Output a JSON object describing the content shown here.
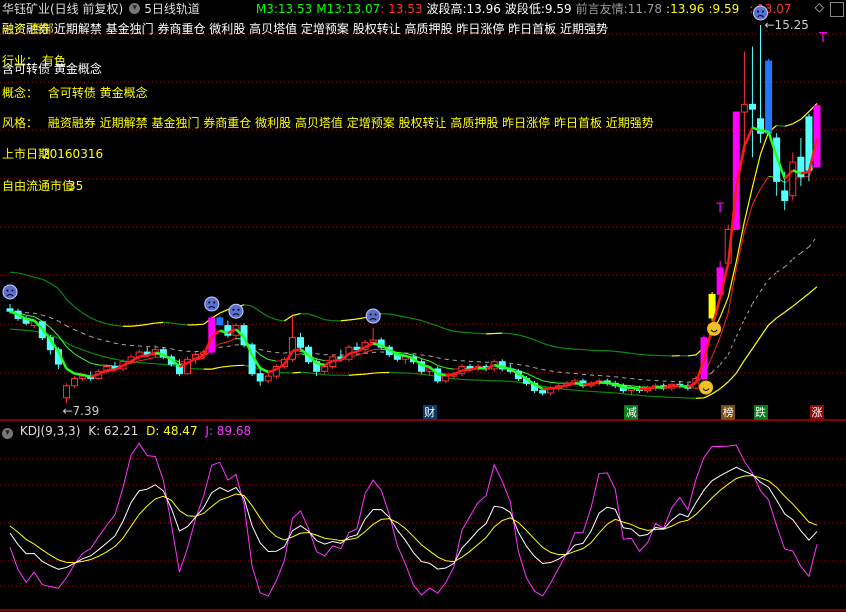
{
  "header": {
    "title": "华钰矿业(日线 前复权)",
    "indicator_name": "5日线轨道",
    "m3_label": "M3:",
    "m3_value": "13.53",
    "m13_label": "M13:",
    "m13_value": "13.07",
    "red_value": ": 13.53",
    "wave_high_label": "波段高:",
    "wave_high_value": "13.96",
    "wave_low_label": "波段低:",
    "wave_low_value": "9.59",
    "friend_label": "前言友情:",
    "friend_value": "11.78",
    "friend_y1": ":13.96",
    "friend_y2": ":9.59",
    "friend_r": ": 13.07"
  },
  "overlay": {
    "tags_line": "融资融券 近期解禁 基金独门 券商重仓 微利股 高贝塔值 定增预案 股权转让 高质押股 昨日涨停 昨日首板 近期强势",
    "tags_overlap": "融资 西部",
    "industry_label": "行业：  有色",
    "industry_overlap": "含可转债 黄金概念",
    "concept_label": "概念：",
    "concept_value": "含可转债 黄金概念",
    "style_label": "风格：",
    "style_value": "融资融券 近期解禁 基金独门 券商重仓 微利股 高贝塔值 定增预案 股权转让 高质押股 昨日涨停 昨日首板 近期强势",
    "listing_label": "上市日期",
    "listing_value": "20160316",
    "float_label": "自由流通市值",
    "float_value": "35"
  },
  "chart_data": {
    "type": "candlestick",
    "price_high_label": "15.25",
    "price_low_label": "7.39",
    "ylim": [
      7.2,
      15.6
    ],
    "candles_ohlc": [
      [
        9.35,
        9.45,
        9.25,
        9.3
      ],
      [
        9.3,
        9.35,
        9.1,
        9.15
      ],
      [
        9.15,
        9.2,
        9.0,
        9.05
      ],
      [
        9.0,
        9.1,
        8.95,
        9.08
      ],
      [
        9.08,
        9.1,
        8.7,
        8.75
      ],
      [
        8.75,
        8.8,
        8.4,
        8.5
      ],
      [
        8.5,
        8.55,
        8.1,
        8.2
      ],
      [
        7.5,
        7.8,
        7.39,
        7.75
      ],
      [
        7.75,
        7.95,
        7.7,
        7.9
      ],
      [
        7.9,
        8.0,
        7.85,
        7.95
      ],
      [
        7.95,
        8.05,
        7.85,
        7.9
      ],
      [
        7.9,
        8.1,
        7.88,
        8.05
      ],
      [
        8.05,
        8.2,
        8.0,
        8.15
      ],
      [
        8.15,
        8.25,
        8.05,
        8.1
      ],
      [
        8.1,
        8.3,
        8.05,
        8.25
      ],
      [
        8.25,
        8.4,
        8.2,
        8.35
      ],
      [
        8.35,
        8.5,
        8.3,
        8.45
      ],
      [
        8.45,
        8.55,
        8.35,
        8.4
      ],
      [
        8.4,
        8.6,
        8.35,
        8.5
      ],
      [
        8.5,
        8.55,
        8.3,
        8.35
      ],
      [
        8.35,
        8.4,
        8.15,
        8.2
      ],
      [
        8.2,
        8.3,
        7.95,
        8.0
      ],
      [
        8.0,
        8.35,
        7.98,
        8.3
      ],
      [
        8.3,
        8.45,
        8.2,
        8.4
      ],
      [
        8.4,
        8.5,
        8.3,
        8.45
      ],
      [
        8.45,
        9.2,
        8.4,
        9.16
      ],
      [
        9.16,
        9.2,
        9.0,
        9.02
      ],
      [
        9.0,
        9.1,
        8.75,
        8.8
      ],
      [
        8.8,
        9.05,
        8.7,
        9.0
      ],
      [
        9.0,
        9.05,
        8.55,
        8.6
      ],
      [
        8.6,
        8.65,
        7.95,
        8.0
      ],
      [
        8.0,
        8.1,
        7.75,
        7.85
      ],
      [
        7.85,
        8.05,
        7.8,
        7.95
      ],
      [
        7.95,
        8.2,
        7.9,
        8.15
      ],
      [
        8.15,
        8.35,
        8.1,
        8.3
      ],
      [
        8.3,
        9.2,
        8.25,
        8.75
      ],
      [
        8.75,
        8.85,
        8.5,
        8.55
      ],
      [
        8.55,
        8.6,
        8.2,
        8.25
      ],
      [
        8.25,
        8.3,
        7.95,
        8.05
      ],
      [
        8.05,
        8.2,
        8.0,
        8.15
      ],
      [
        8.15,
        8.4,
        8.1,
        8.35
      ],
      [
        8.35,
        8.5,
        8.25,
        8.3
      ],
      [
        8.3,
        8.6,
        8.25,
        8.55
      ],
      [
        8.55,
        8.65,
        8.45,
        8.5
      ],
      [
        8.5,
        8.7,
        8.45,
        8.65
      ],
      [
        8.65,
        8.95,
        8.6,
        8.7
      ],
      [
        8.7,
        8.75,
        8.5,
        8.55
      ],
      [
        8.55,
        8.6,
        8.35,
        8.4
      ],
      [
        8.4,
        8.45,
        8.25,
        8.3
      ],
      [
        8.3,
        8.4,
        8.2,
        8.35
      ],
      [
        8.35,
        8.4,
        8.2,
        8.25
      ],
      [
        8.25,
        8.3,
        8.0,
        8.05
      ],
      [
        8.05,
        8.15,
        7.95,
        8.1
      ],
      [
        8.1,
        8.15,
        7.8,
        7.85
      ],
      [
        7.85,
        8.0,
        7.8,
        7.95
      ],
      [
        7.95,
        8.05,
        7.9,
        8.0
      ],
      [
        8.0,
        8.2,
        7.95,
        8.15
      ],
      [
        8.15,
        8.2,
        8.05,
        8.1
      ],
      [
        8.1,
        8.2,
        8.05,
        8.15
      ],
      [
        8.15,
        8.2,
        8.05,
        8.1
      ],
      [
        8.1,
        8.3,
        8.05,
        8.25
      ],
      [
        8.25,
        8.3,
        8.05,
        8.1
      ],
      [
        8.1,
        8.2,
        8.0,
        8.05
      ],
      [
        8.05,
        8.1,
        7.85,
        7.9
      ],
      [
        7.9,
        7.95,
        7.75,
        7.8
      ],
      [
        7.8,
        7.85,
        7.6,
        7.65
      ],
      [
        7.65,
        7.7,
        7.55,
        7.6
      ],
      [
        7.6,
        7.75,
        7.55,
        7.7
      ],
      [
        7.7,
        7.8,
        7.65,
        7.75
      ],
      [
        7.75,
        7.85,
        7.7,
        7.8
      ],
      [
        7.8,
        7.9,
        7.75,
        7.85
      ],
      [
        7.85,
        7.9,
        7.7,
        7.75
      ],
      [
        7.75,
        7.85,
        7.7,
        7.8
      ],
      [
        7.8,
        7.9,
        7.75,
        7.85
      ],
      [
        7.85,
        7.9,
        7.75,
        7.8
      ],
      [
        7.8,
        7.85,
        7.7,
        7.75
      ],
      [
        7.75,
        7.8,
        7.6,
        7.65
      ],
      [
        7.65,
        7.75,
        7.55,
        7.7
      ],
      [
        7.7,
        7.75,
        7.6,
        7.65
      ],
      [
        7.65,
        7.75,
        7.6,
        7.7
      ],
      [
        7.7,
        7.8,
        7.65,
        7.75
      ],
      [
        7.75,
        7.8,
        7.65,
        7.7
      ],
      [
        7.7,
        7.8,
        7.65,
        7.78
      ],
      [
        7.78,
        7.85,
        7.7,
        7.75
      ],
      [
        7.75,
        7.8,
        7.65,
        7.7
      ],
      [
        7.7,
        7.95,
        7.68,
        7.9
      ],
      [
        7.9,
        8.8,
        7.88,
        8.75
      ],
      [
        9.16,
        9.7,
        9.1,
        9.65
      ],
      [
        9.65,
        10.35,
        9.6,
        10.2
      ],
      [
        10.3,
        11.1,
        10.25,
        11.0
      ],
      [
        11.0,
        13.45,
        11.0,
        13.44
      ],
      [
        13.44,
        14.7,
        12.6,
        13.6
      ],
      [
        13.6,
        14.8,
        12.5,
        13.5
      ],
      [
        13.3,
        15.25,
        12.8,
        13.0
      ],
      [
        14.5,
        14.55,
        13.0,
        13.0
      ],
      [
        12.9,
        13.0,
        11.7,
        12.0
      ],
      [
        11.8,
        12.2,
        11.4,
        11.6
      ],
      [
        11.7,
        12.6,
        11.6,
        12.4
      ],
      [
        12.5,
        12.9,
        11.9,
        12.1
      ],
      [
        13.34,
        13.4,
        12.0,
        12.23
      ],
      [
        12.3,
        13.6,
        12.3,
        13.57
      ]
    ],
    "limit_up_candles": [
      25,
      86,
      88,
      90,
      100
    ],
    "strong_bear_candles": [
      26,
      94
    ],
    "yellow_candles": [
      87
    ],
    "sad_face_candles": [
      0,
      25,
      28,
      45,
      93
    ],
    "smile_face_candles": [
      86,
      87
    ],
    "t_marker_candles": [
      88,
      100
    ],
    "event_markers": [
      {
        "idx": 52,
        "label": "财",
        "color": "#0a3a66"
      },
      {
        "idx": 77,
        "label": "减",
        "color": "#0a7a1a"
      },
      {
        "idx": 89,
        "label": "榜",
        "color": "#7a4a10"
      },
      {
        "idx": 93,
        "label": "跌",
        "color": "#0a7a1a"
      },
      {
        "idx": 100,
        "label": "涨",
        "color": "#8a0a0a"
      }
    ],
    "colors": {
      "bull": "#ff3232",
      "bear": "#54ffff",
      "limit_up": "#ff00ff",
      "strong_bear": "#1e78ff",
      "yellow": "#ffff00",
      "grid": "#c00000"
    }
  },
  "kdj": {
    "title": "KDJ(9,3,3)",
    "k_label": "K: 62.21",
    "d_label": "D: 48.47",
    "j_label": "J: 89.68",
    "ylim": [
      -15,
      125
    ],
    "colors": {
      "k": "#ffffff",
      "d": "#ffff00",
      "j": "#ff33ff"
    }
  }
}
